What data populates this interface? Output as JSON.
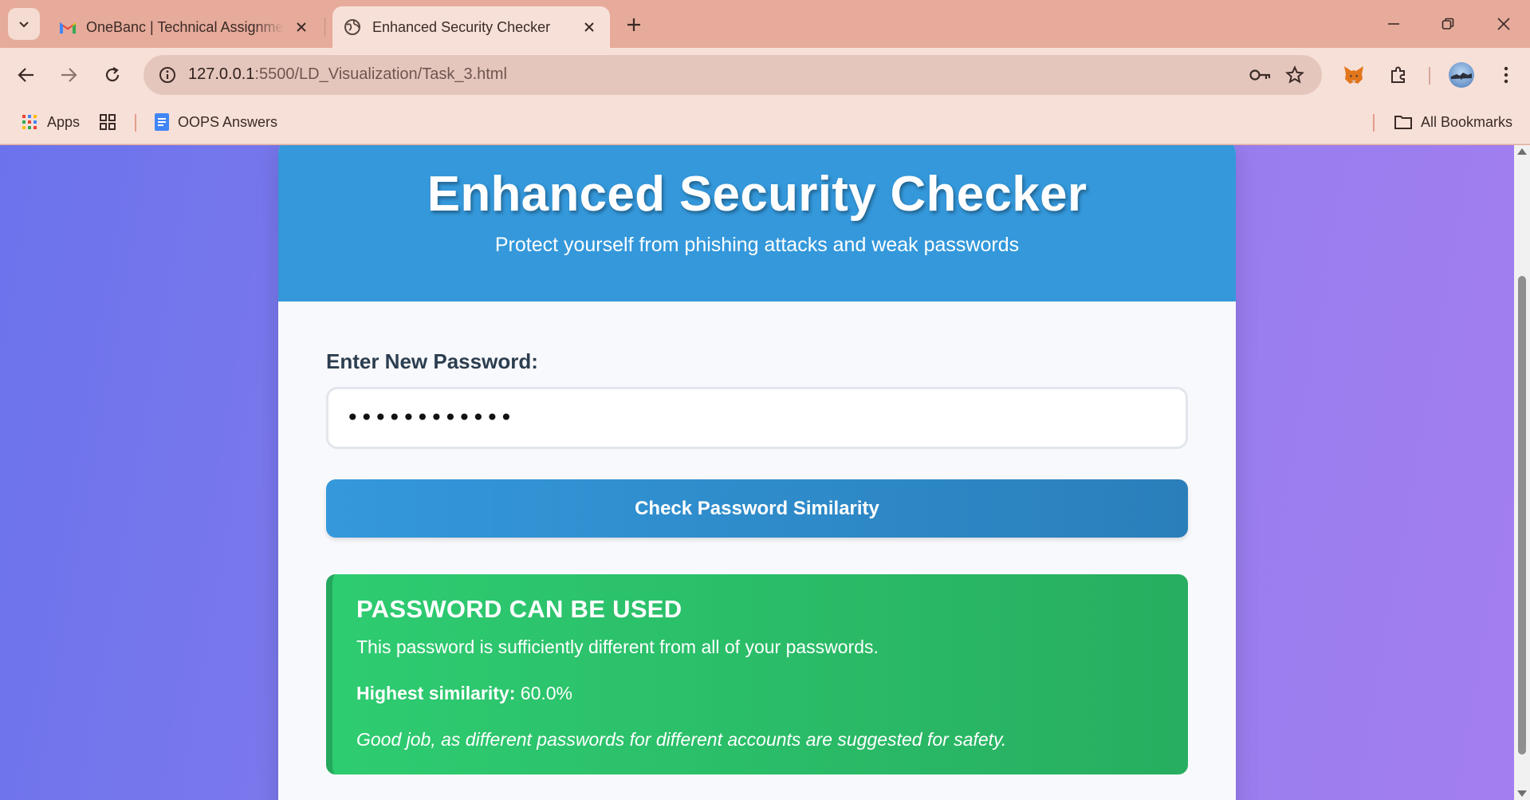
{
  "browser": {
    "tabs": [
      {
        "title": "OneBanc | Technical Assignment",
        "favicon": "gmail-icon",
        "active": false
      },
      {
        "title": "Enhanced Security Checker",
        "favicon": "globe-icon",
        "active": true
      }
    ],
    "url": {
      "host": "127.0.0.1",
      "path": ":5500/LD_Visualization/Task_3.html"
    },
    "bookmarks": [
      {
        "label": "Apps",
        "icon": "apps-grid-icon"
      },
      {
        "label": "OOPS Answers",
        "icon": "docs-icon"
      }
    ],
    "all_bookmarks_label": "All Bookmarks"
  },
  "page": {
    "title": "Enhanced Security Checker",
    "subtitle": "Protect yourself from phishing attacks and weak passwords",
    "password_label": "Enter New Password:",
    "password_value": "••••••••••••",
    "check_button": "Check Password Similarity",
    "result": {
      "status": "PASSWORD CAN BE USED",
      "message": "This password is sufficiently different from all of your passwords.",
      "similarity_label": "Highest similarity:",
      "similarity_value": "60.0%",
      "note": "Good job, as different passwords for different accounts are suggested for safety."
    }
  },
  "colors": {
    "header": "#3498db",
    "success": "#2ecc71",
    "text_dark": "#2c3e50",
    "browser_frame": "#e6ab9b"
  }
}
